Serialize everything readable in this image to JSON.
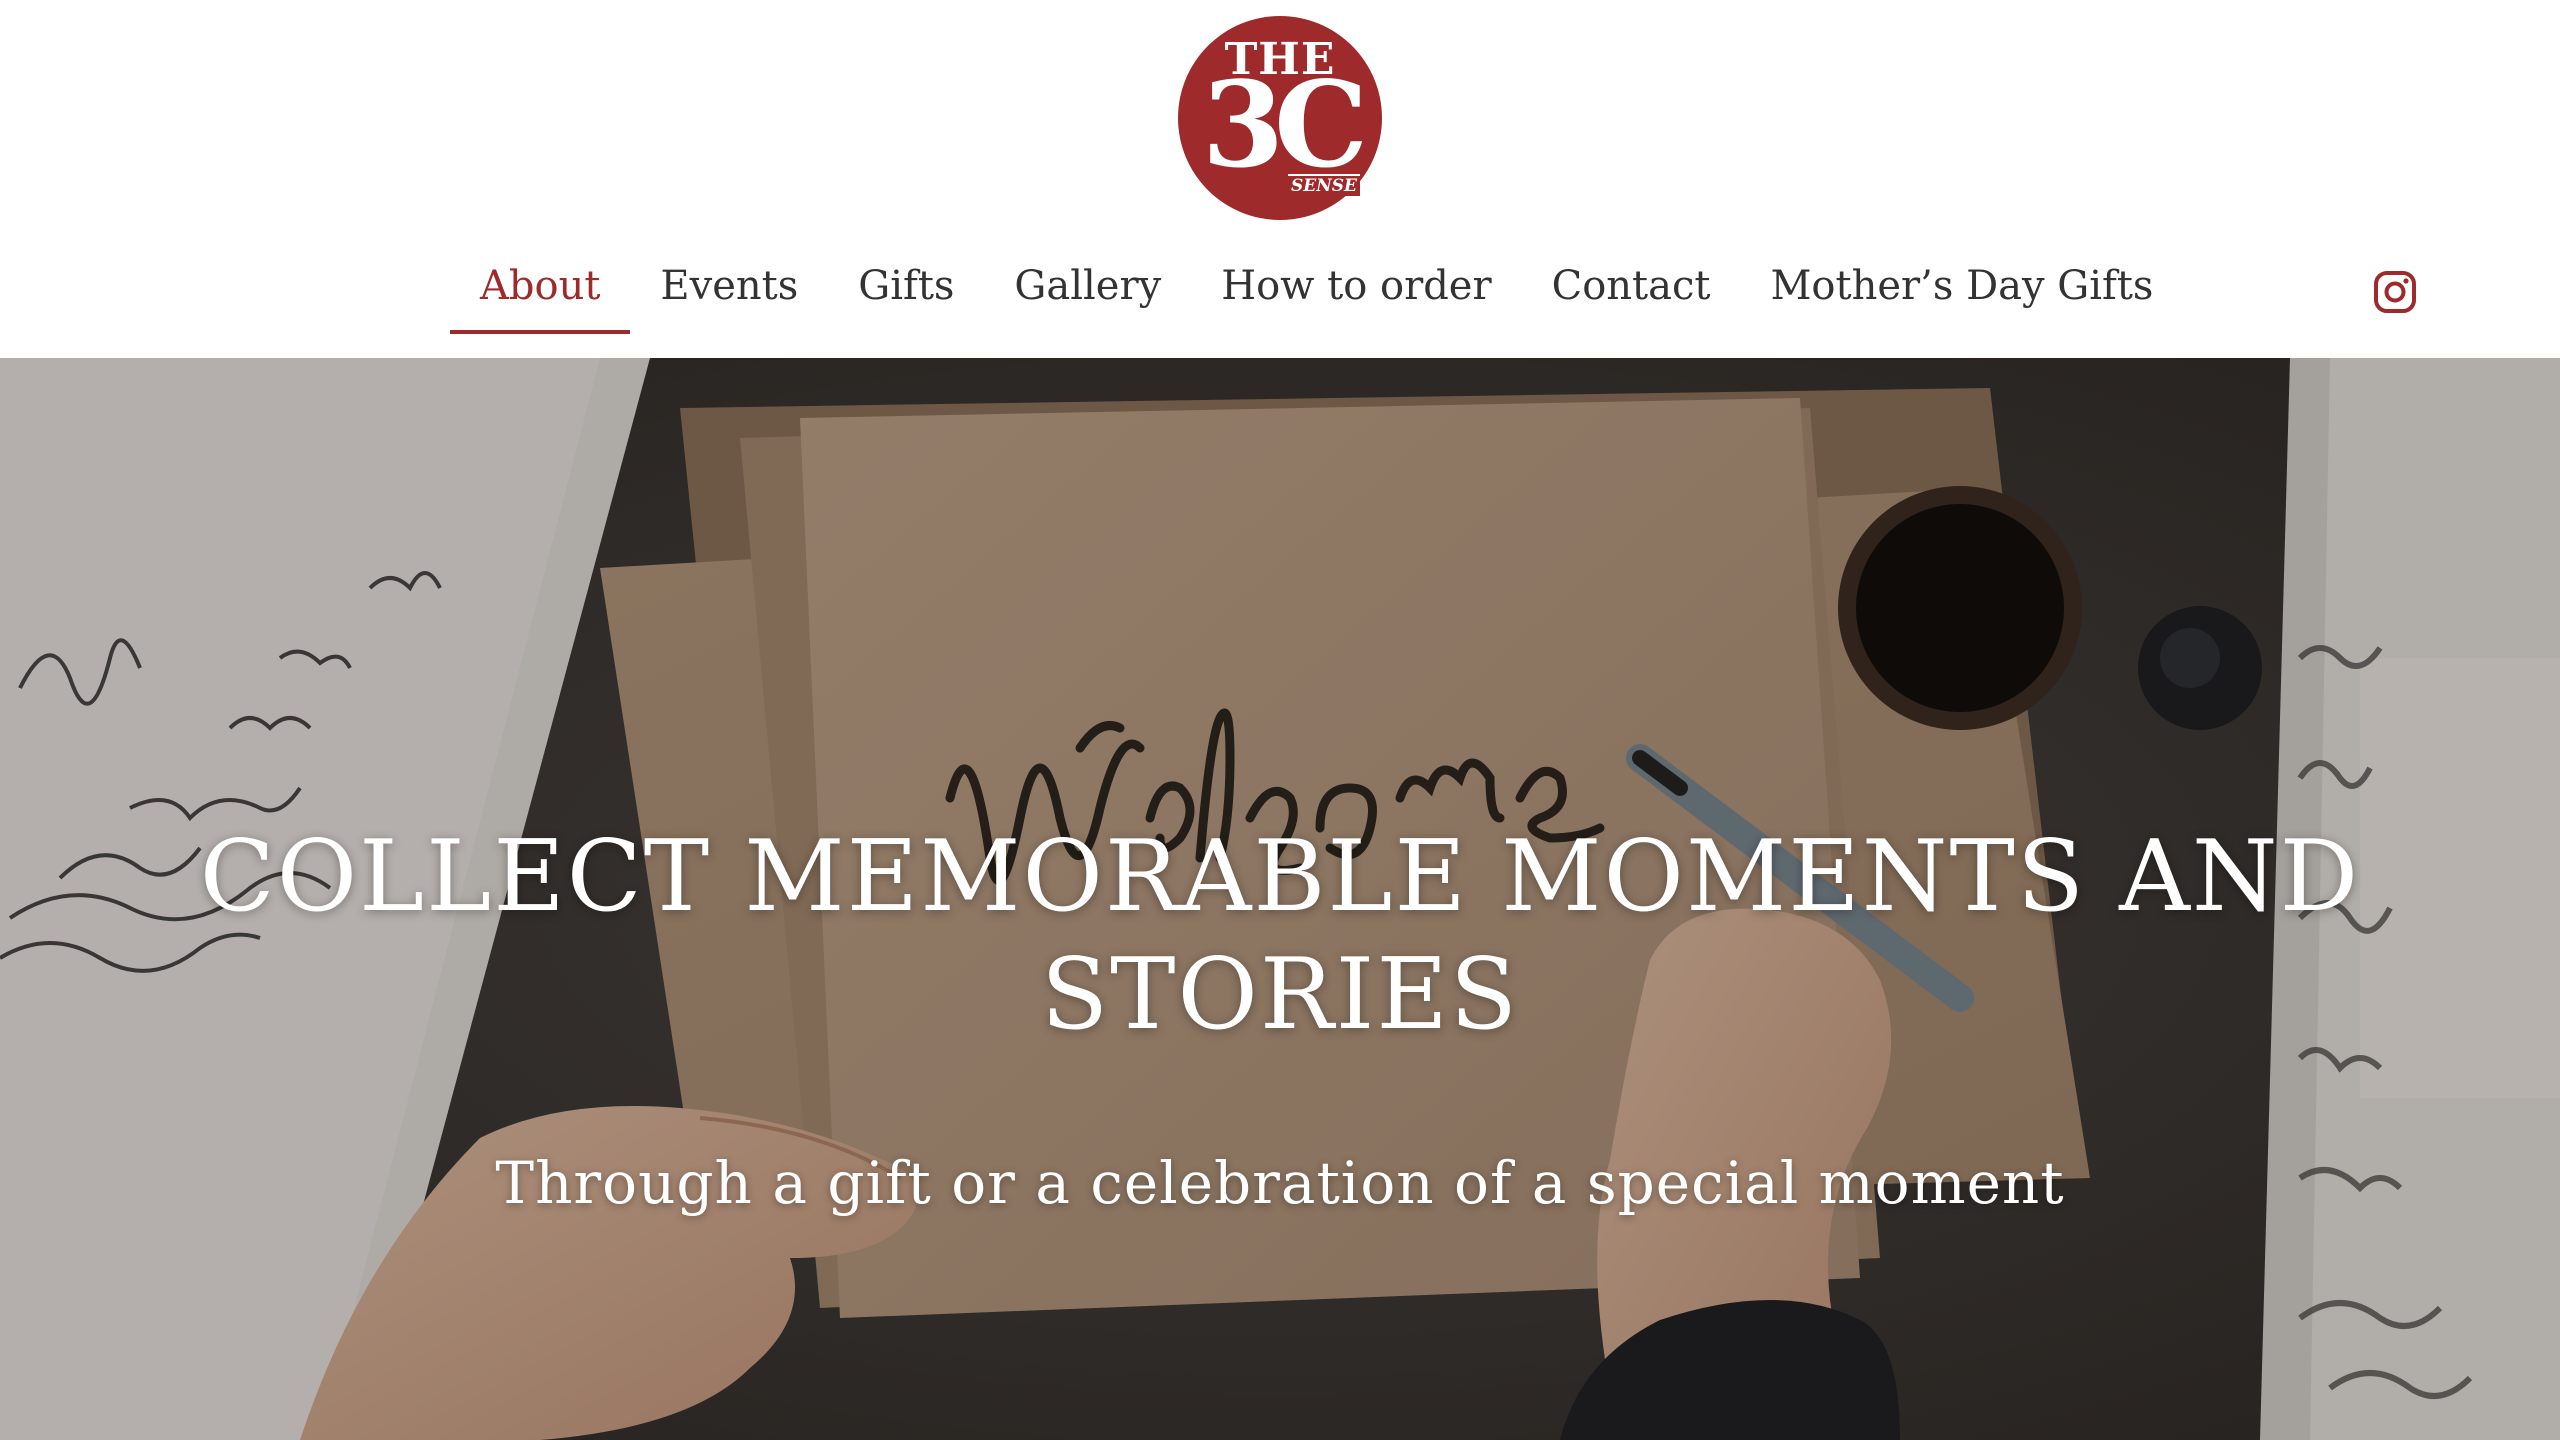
{
  "brand": {
    "logo_top": "THE",
    "logo_mark": "3C",
    "logo_sub": "SENSE",
    "accent_color": "#9e2a2b"
  },
  "nav": {
    "items": [
      {
        "label": "About",
        "active": true
      },
      {
        "label": "Events",
        "active": false
      },
      {
        "label": "Gifts",
        "active": false
      },
      {
        "label": "Gallery",
        "active": false
      },
      {
        "label": "How to order",
        "active": false
      },
      {
        "label": "Contact",
        "active": false
      },
      {
        "label": "Mother’s Day Gifts",
        "active": false
      }
    ],
    "social_icon": "instagram-icon"
  },
  "hero": {
    "title": "COLLECT MEMORABLE MOMENTS AND STORIES",
    "subtitle": "Through a gift or a celebration of a special moment",
    "background": "photo of hands writing calligraphy 'Welcome' on kraft paper"
  }
}
